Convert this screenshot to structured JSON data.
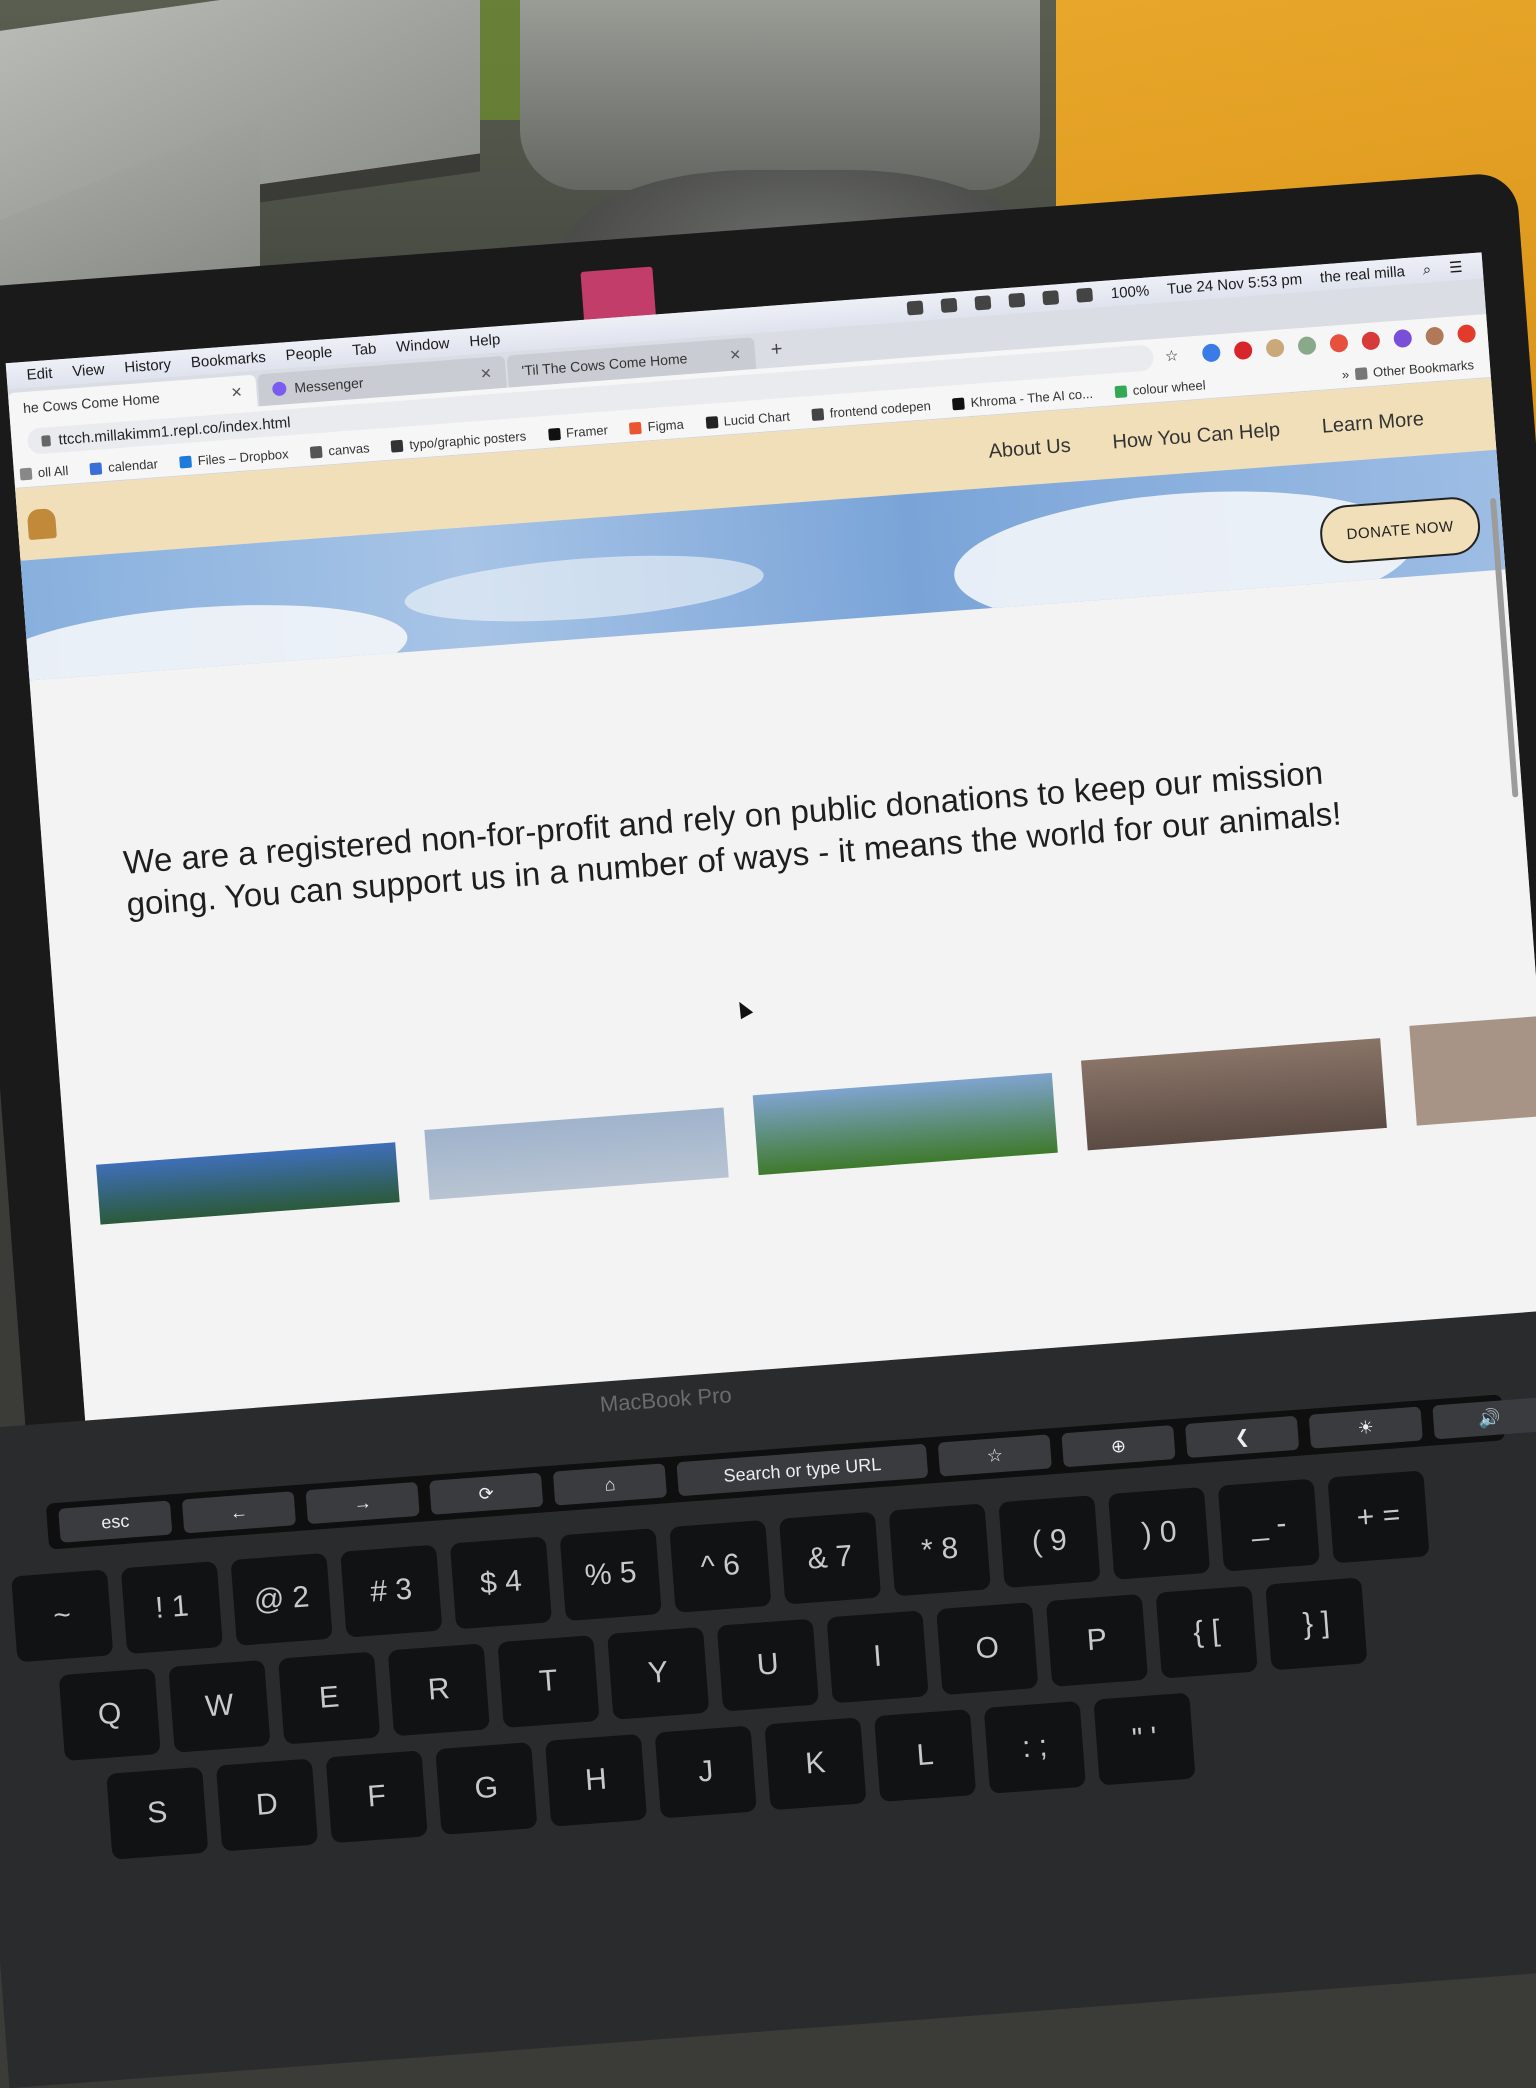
{
  "menubar": {
    "menus": [
      "Edit",
      "View",
      "History",
      "Bookmarks",
      "People",
      "Tab",
      "Window",
      "Help"
    ],
    "battery": "100%",
    "datetime": "Tue 24 Nov  5:53 pm",
    "user": "the real milla"
  },
  "tabs": [
    {
      "title": "he Cows Come Home",
      "active": true
    },
    {
      "title": "Messenger",
      "active": false
    },
    {
      "title": "'Til The Cows Come Home",
      "active": false
    }
  ],
  "new_tab": "+",
  "url": "ttcch.millakimm1.repl.co/index.html",
  "bookmarks": [
    "oll All",
    "calendar",
    "Files – Dropbox",
    "canvas",
    "typo/graphic posters",
    "Framer",
    "Figma",
    "Lucid Chart",
    "frontend codepen",
    "Khroma - The AI co...",
    "colour wheel"
  ],
  "bookmarks_more": "»",
  "other_bookmarks": "Other Bookmarks",
  "site": {
    "nav": [
      "About Us",
      "How You Can Help",
      "Learn More"
    ],
    "donate": "DONATE NOW",
    "mission": "We are a registered non-for-profit and rely on public donations to keep our mission going. You can support us in a number of ways - it means the world for our animals!"
  },
  "laptop": {
    "brand": "MacBook Pro",
    "touchbar": [
      "esc",
      "←",
      "→",
      "⟳",
      "⌂",
      "Search or type URL",
      "☆",
      "⊕",
      "❮",
      "☀",
      "🔊",
      "🔇"
    ],
    "key_rows": [
      [
        "~",
        "! 1",
        "@ 2",
        "# 3",
        "$ 4",
        "% 5",
        "^ 6",
        "& 7",
        "* 8",
        "( 9",
        ") 0",
        "_ -",
        "+ ="
      ],
      [
        "Q",
        "W",
        "E",
        "R",
        "T",
        "Y",
        "U",
        "I",
        "O",
        "P",
        "{ [",
        "} ]"
      ],
      [
        "S",
        "D",
        "F",
        "G",
        "H",
        "J",
        "K",
        "L",
        ": ;",
        "\" '"
      ]
    ]
  },
  "colors": {
    "nav_bg": "#f0dfb8",
    "sky": "#88b0de",
    "page_bg": "#f3f3f4",
    "jumper": "#e8a72a"
  }
}
